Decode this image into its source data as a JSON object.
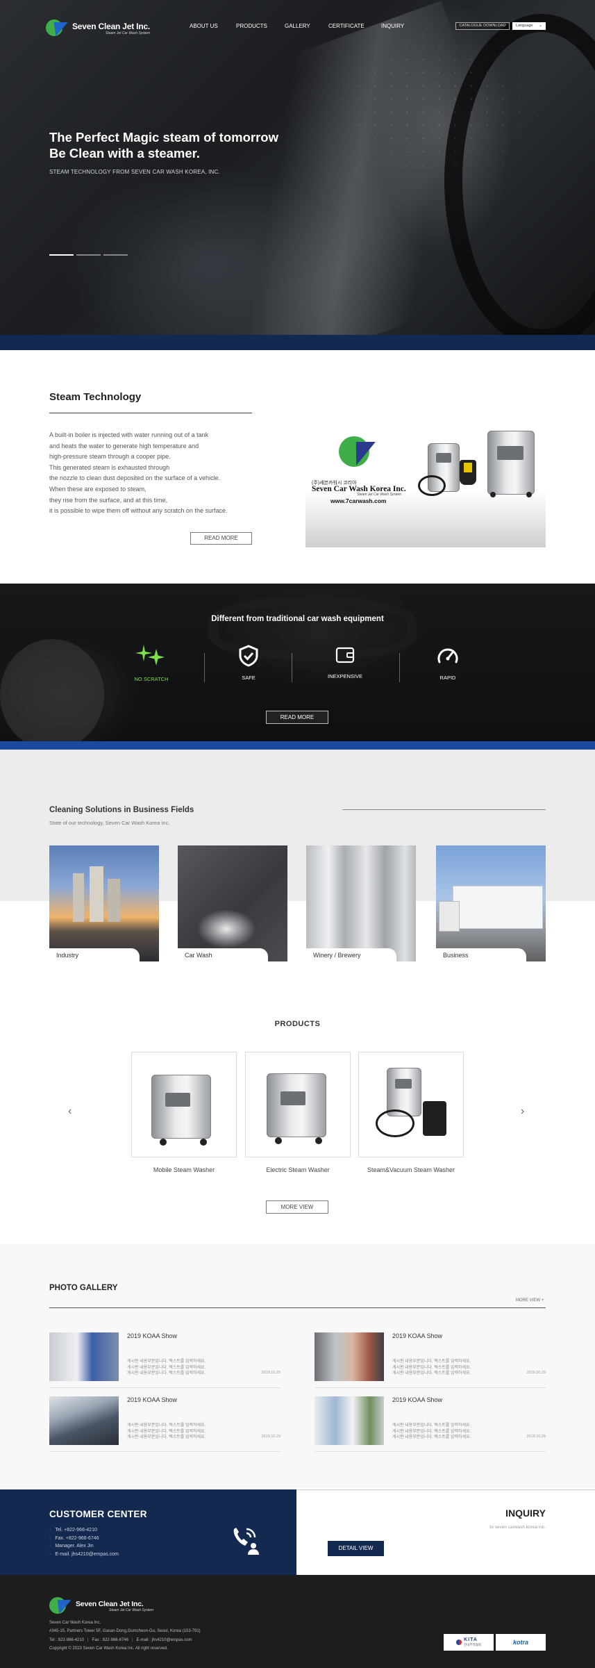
{
  "brand": {
    "name": "Seven Clean Jet Inc.",
    "tagline": "Steam Jet Car Wash System"
  },
  "nav": {
    "items": [
      "ABOUT US",
      "PRODUCTS",
      "GALLERY",
      "CERTIFICATE",
      "INQUIRY"
    ]
  },
  "header": {
    "catalog_label": "CATALOGUE DOWNLOAD",
    "language_label": "Language"
  },
  "hero": {
    "title_line1": "The Perfect Magic steam of tomorrow",
    "title_line2": "Be Clean with a steamer.",
    "subtitle": "STEAM TECHNOLOGY FROM SEVEN CAR WASH KOREA, INC."
  },
  "steam": {
    "title": "Steam Technology",
    "body": "A built-in boiler is injected with water running out of a tank\nand heats the water to generate  high temperature and\nhigh-pressure steam through a cooper pipe.\nThis generated steam is exhausted through\nthe nozzle to clean dust deposited on the surface of a vehicle.\nWhen these are exposed to steam,\nthey rise from the surface, and at this time,\nit is possible to wipe them off without any scratch on the surface.",
    "button": "READ MORE",
    "image": {
      "korean": "(주)세븐카워시 코리아",
      "company": "Seven Car Wash Korea Inc.",
      "company_sub": "Steam Jet Car Wash System",
      "url": "www.7carwash.com"
    }
  },
  "diff": {
    "title": "Different from traditional car wash equipment",
    "features": [
      {
        "label": "NO SCRATCH",
        "icon": "sparkle-icon"
      },
      {
        "label": "SAFE",
        "icon": "shield-check-icon"
      },
      {
        "label": "INEXPENSIVE",
        "icon": "wallet-icon"
      },
      {
        "label": "RAPID",
        "icon": "speedometer-icon"
      }
    ],
    "button": "READ MORE"
  },
  "solutions": {
    "title": "Cleaning Solutions in Business Fields",
    "subtitle": "State of our technology, Seven Car Wash Korea Inc.",
    "cards": [
      "Industry",
      "Car Wash",
      "Winery / Brewery",
      "Business"
    ]
  },
  "products": {
    "title": "PRODUCTS",
    "items": [
      "Mobile Steam Washer",
      "Electric Steam Washer",
      "Steam&Vacuum Steam Washer"
    ],
    "button": "MORE VIEW"
  },
  "gallery": {
    "title": "PHOTO GALLERY",
    "more": "MORE VIEW +",
    "items": [
      {
        "title": "2019 KOAA Show",
        "desc": "게시판 내용부분입니다. 텍스트를 입력하세요.\n게시판 내용부분입니다. 텍스트를 입력하세요.\n게시판 내용부분입니다. 텍스트를 입력하세요.",
        "date": "2019.10.29"
      },
      {
        "title": "2019 KOAA Show",
        "desc": "게시판 내용부분입니다. 텍스트를 입력하세요.\n게시판 내용부분입니다. 텍스트를 입력하세요.\n게시판 내용부분입니다. 텍스트를 입력하세요.",
        "date": "2019.10.29"
      },
      {
        "title": "2019 KOAA Show",
        "desc": "게시판 내용부분입니다. 텍스트를 입력하세요.\n게시판 내용부분입니다. 텍스트를 입력하세요.\n게시판 내용부분입니다. 텍스트를 입력하세요.",
        "date": "2019.10.29"
      },
      {
        "title": "2019 KOAA Show",
        "desc": "게시판 내용부분입니다. 텍스트를 입력하세요.\n게시판 내용부분입니다. 텍스트를 입력하세요.\n게시판 내용부분입니다. 텍스트를 입력하세요.",
        "date": "2019.10.29"
      }
    ]
  },
  "customer": {
    "title": "CUSTOMER CENTER",
    "lines": [
      "Tel. +822-966-4210",
      "Fax. +822-966-6746",
      "Manager. Alex Jin",
      "E-mail. jhs4210@empas.com"
    ]
  },
  "inquiry": {
    "title": "INQUIRY",
    "subtitle": "to seven carwash korea inc.",
    "button": "DETAIL VIEW"
  },
  "footer": {
    "company": "Seven Car Wash Korea Inc.",
    "address": "#345-15, Partners Tower 5F, Gasan-Dong,Gumcheon-Gu, Seoul, Korea (153-791)",
    "tel": "Tel : 822-966-4210",
    "fax": "Fax : 822-966-6746",
    "email": "E-mail : jhs4210@empas.com",
    "copyright": "Copyright © 2023 Seven Car Wash Korea Inc. All right reserved.",
    "badges": [
      "KITA",
      "kotra"
    ],
    "badge_sub": "한국무역협회"
  },
  "colors": {
    "navy": "#14294f",
    "blue_band": "#1c4a9e",
    "green": "#3fae49",
    "accent_green": "#7ee04a"
  }
}
